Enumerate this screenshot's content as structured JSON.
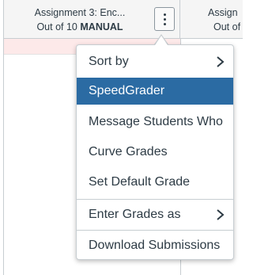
{
  "columns": [
    {
      "title": "Assignment 3: Enc...",
      "points_prefix": "Out of 10",
      "grading_type": "MANUAL"
    },
    {
      "title": "Assign",
      "points_prefix": "Out of"
    }
  ],
  "menu": {
    "items": [
      {
        "label": "Sort by",
        "submenu": true
      },
      {
        "label": "SpeedGrader",
        "active": true
      },
      {
        "label": "Message Students Who"
      },
      {
        "label": "Curve Grades"
      },
      {
        "label": "Set Default Grade"
      },
      {
        "label": "Enter Grades as",
        "submenu": true
      },
      {
        "label": "Download Submissions"
      }
    ]
  },
  "colors": {
    "highlight": "#2b6ba3",
    "row_strip": "#fde9e9",
    "text": "#2d3b45",
    "border": "#c7cdd1"
  },
  "icons": {
    "column_options": "kebab-vertical-icon",
    "submenu": "chevron-right-icon"
  }
}
